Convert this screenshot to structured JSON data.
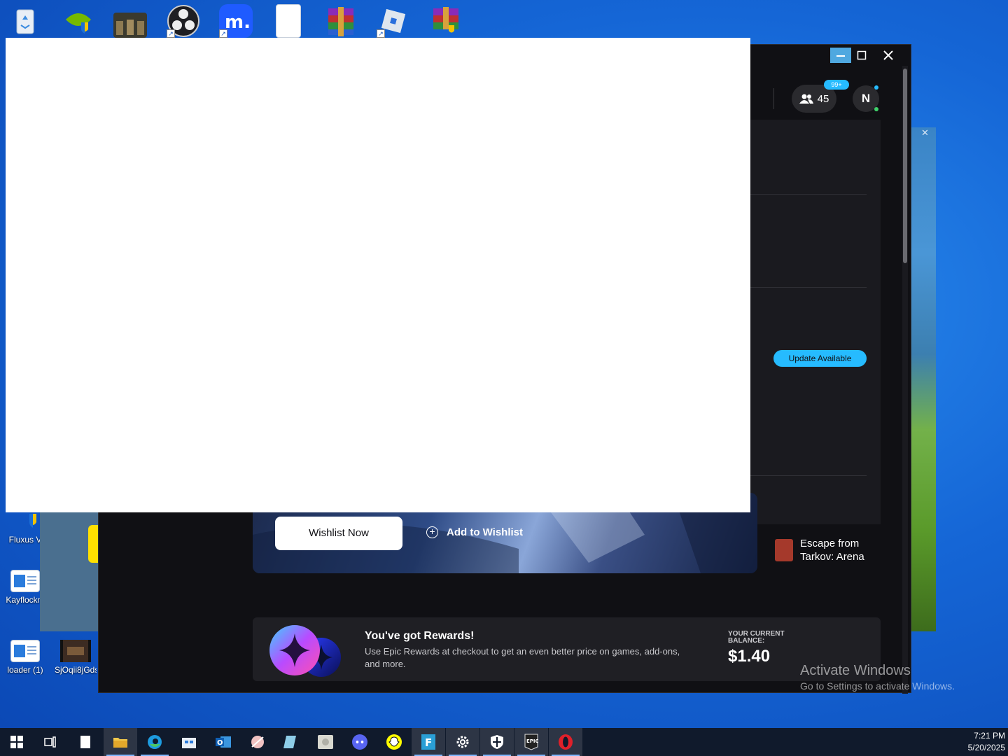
{
  "desktop": {
    "icons": [
      {
        "label": "",
        "icon": "recycle-bin-icon"
      },
      {
        "label": "",
        "icon": "nvidia-shield-icon"
      },
      {
        "label": "",
        "icon": "photo-thumbnail-icon"
      },
      {
        "label": "",
        "icon": "obs-studio-icon"
      },
      {
        "label": "",
        "icon": "motrix-icon"
      },
      {
        "label": "",
        "icon": "blank-document-icon"
      },
      {
        "label": "",
        "icon": "winrar-icon"
      },
      {
        "label": "",
        "icon": "roblox-icon"
      },
      {
        "label": "",
        "icon": "winrar-shield-icon"
      },
      {
        "label": "Fluxus V",
        "icon": "shield-icon"
      },
      {
        "label": "Kayflockm",
        "icon": "window-app-icon"
      },
      {
        "label": "loader (1)",
        "icon": "window-app-icon"
      },
      {
        "label": "SjOqii8jGds.",
        "icon": "video-thumbnail-icon"
      }
    ]
  },
  "epic": {
    "friends_count": "45",
    "notifications": "99+",
    "avatar_initial": "N",
    "update_button": "Update Available",
    "hero": {
      "primary_button": "Wishlist Now",
      "secondary_button": "Add to Wishlist"
    },
    "sidebar_game": "Escape from Tarkov: Arena",
    "rewards": {
      "title": "You've got Rewards!",
      "description": "Use Epic Rewards at checkout to get an even better price on games, add-ons, and more.",
      "balance_label": "YOUR CURRENT BALANCE:",
      "balance_value": "$1.40"
    }
  },
  "watermark": {
    "title": "Activate Windows",
    "subtitle": "Go to Settings to activate Windows."
  },
  "taskbar": {
    "apps": [
      {
        "name": "start-icon"
      },
      {
        "name": "task-view-icon"
      },
      {
        "name": "notepad-icon"
      },
      {
        "name": "file-explorer-icon"
      },
      {
        "name": "edge-icon"
      },
      {
        "name": "store-icon"
      },
      {
        "name": "outlook-icon"
      },
      {
        "name": "snipping-icon"
      },
      {
        "name": "notebook-icon"
      },
      {
        "name": "disc-image-icon"
      },
      {
        "name": "discord-icon"
      },
      {
        "name": "snapchat-icon"
      },
      {
        "name": "files-app-icon"
      },
      {
        "name": "settings-icon"
      },
      {
        "name": "security-icon"
      },
      {
        "name": "epic-games-icon"
      },
      {
        "name": "opera-icon"
      }
    ],
    "time": "7:21 PM",
    "date": "5/20/2025"
  },
  "colors": {
    "epic_accent": "#26bbff",
    "epic_bg": "#101014",
    "taskbar_bg": "#101a2c"
  }
}
